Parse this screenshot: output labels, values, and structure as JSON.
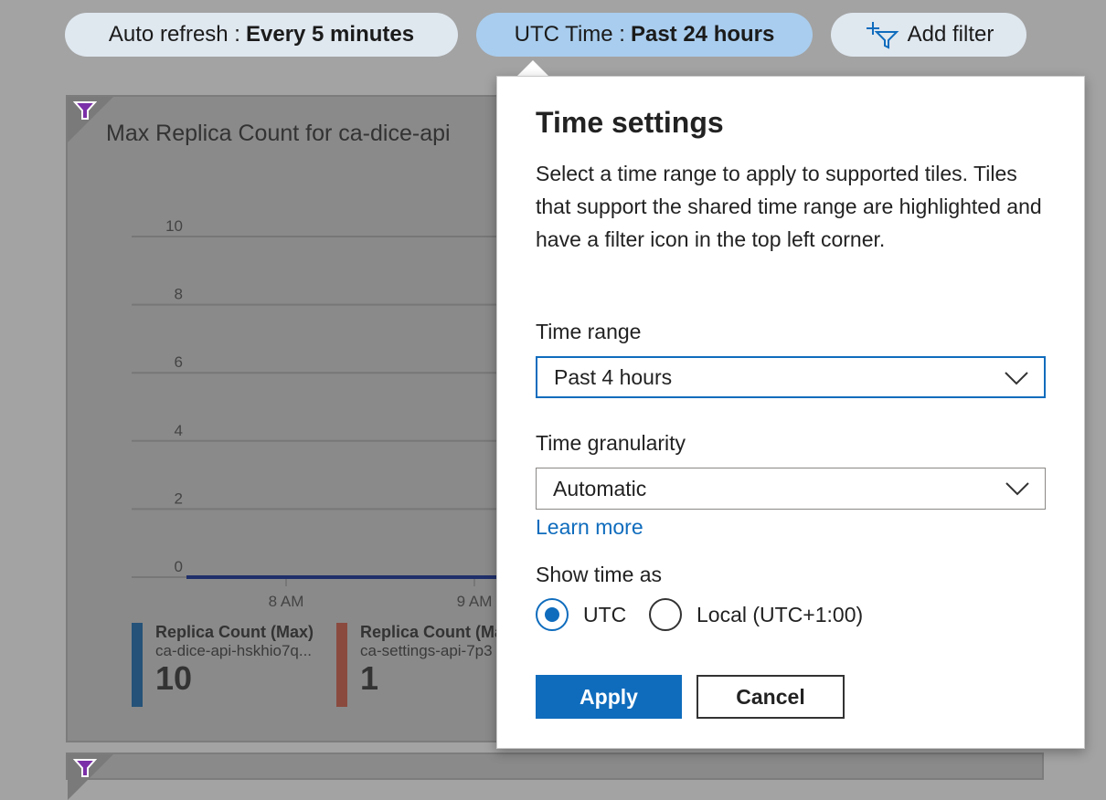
{
  "toolbar": {
    "auto_refresh": {
      "label": "Auto refresh :",
      "value": "Every 5 minutes"
    },
    "time": {
      "label": "UTC Time :",
      "value": "Past 24 hours"
    },
    "add_filter": "Add filter"
  },
  "tile": {
    "title": "Max Replica Count for ca-dice-api",
    "legend": [
      {
        "name": "Replica Count (Max)",
        "resource": "ca-dice-api-hskhio7q...",
        "value": "10",
        "color": "#245278"
      },
      {
        "name": "Replica Count (Max",
        "resource": "ca-settings-api-7p3",
        "value": "1",
        "color": "#8a4a3e"
      }
    ]
  },
  "chart_data": {
    "type": "line",
    "y_ticks": [
      "0",
      "2",
      "4",
      "6",
      "8",
      "10"
    ],
    "ylim": [
      0,
      10
    ],
    "x_ticks": [
      "8 AM",
      "9 AM"
    ],
    "grid": true,
    "series": [
      {
        "color": "#1f2f6a",
        "points": [
          [
            "7:27 AM",
            0
          ],
          [
            "9:07 AM",
            0
          ]
        ]
      }
    ]
  },
  "time_settings": {
    "title": "Time settings",
    "description": "Select a time range to apply to supported tiles. Tiles that support the shared time range are highlighted and have a filter icon in the top left corner.",
    "time_range_label": "Time range",
    "time_range_value": "Past 4 hours",
    "granularity_label": "Time granularity",
    "granularity_value": "Automatic",
    "learn_more": "Learn more",
    "show_time_label": "Show time as",
    "options": [
      "UTC",
      "Local (UTC+1:00)"
    ],
    "selected": "UTC",
    "apply": "Apply",
    "cancel": "Cancel"
  }
}
